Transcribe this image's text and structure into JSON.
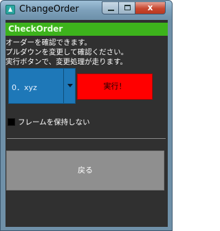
{
  "window": {
    "title": "ChangeOrder",
    "controls": {
      "minimize": "",
      "maximize": "",
      "close": "x"
    }
  },
  "header": {
    "title": "CheckOrder"
  },
  "description": {
    "lines": [
      "オーダーを確認できます。",
      "プルダウンを変更して確認ください。",
      "実行ボタンで、変更処理が走ります。"
    ]
  },
  "order_select": {
    "selected": "0．xyz"
  },
  "execute_button": {
    "label": "実行！"
  },
  "keep_frame": {
    "checked": false,
    "label": "フレームを保持しない"
  },
  "back_button": {
    "label": "戻る"
  },
  "colors": {
    "header_bg": "#3db31c",
    "client_bg": "#303030",
    "select_bg": "#1e78b8",
    "execute_bg": "#ff0000",
    "back_bg": "#8f8f8f"
  }
}
